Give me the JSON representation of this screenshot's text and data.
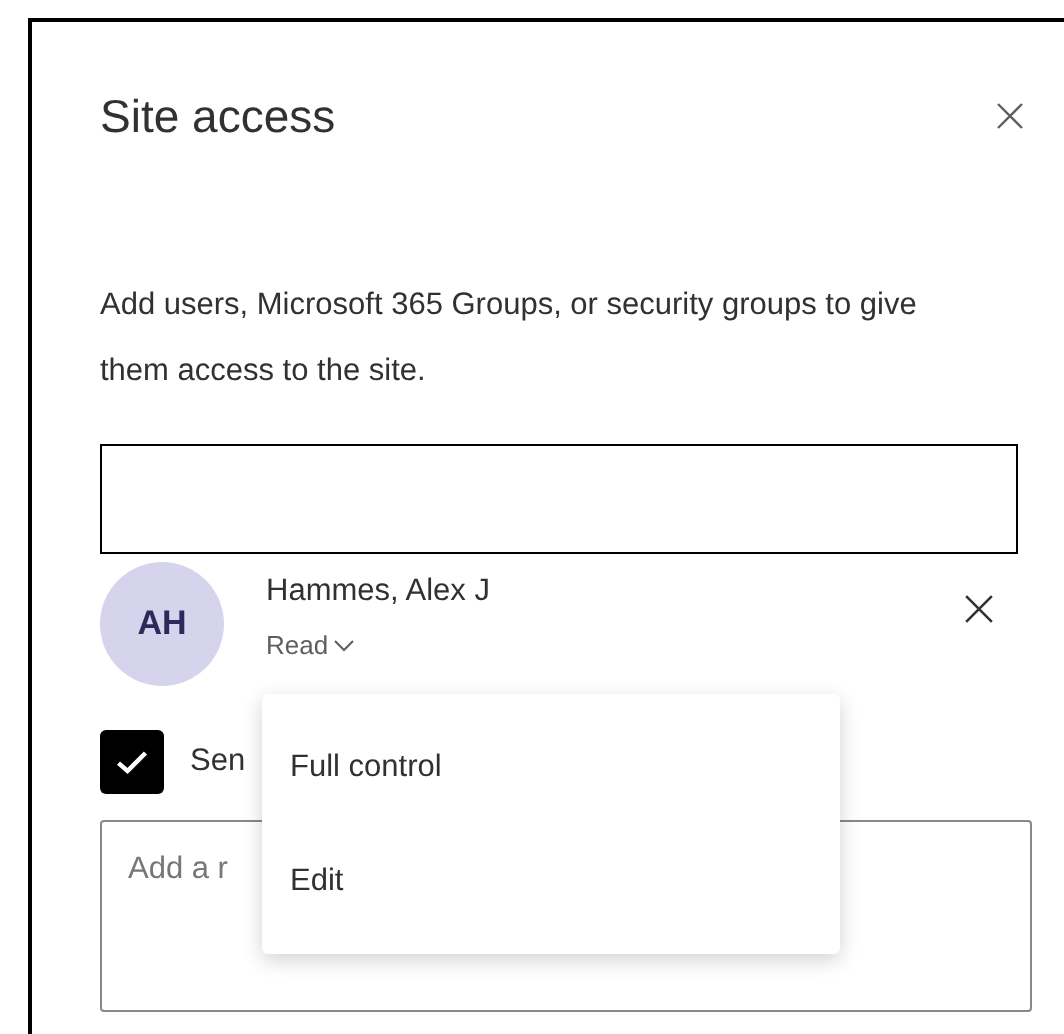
{
  "panel": {
    "title": "Site access",
    "description": "Add users, Microsoft 365 Groups, or security groups to give them access to the site."
  },
  "people": [
    {
      "initials": "AH",
      "name": "Hammes, Alex J",
      "permission": "Read"
    }
  ],
  "send_email": {
    "label": "Sen",
    "checked": true
  },
  "message": {
    "placeholder": "Add a r"
  },
  "permission_menu": {
    "items": [
      {
        "label": "Full control",
        "selected": false
      },
      {
        "label": "Edit",
        "selected": false
      }
    ]
  }
}
